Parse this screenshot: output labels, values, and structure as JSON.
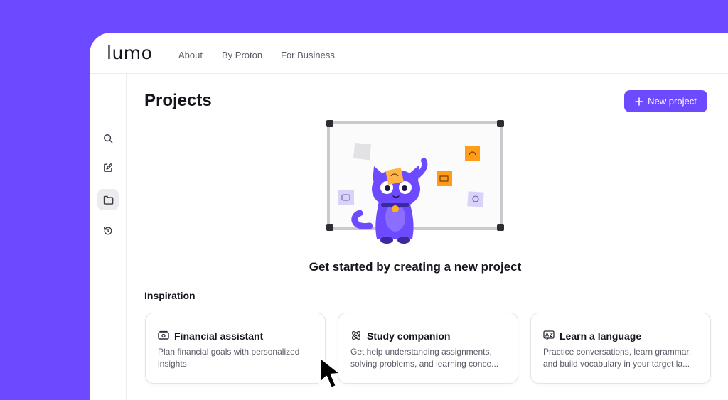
{
  "header": {
    "logo": "lumo",
    "nav": [
      "About",
      "By Proton",
      "For Business"
    ]
  },
  "sidebar": {
    "items": [
      {
        "name": "search",
        "icon": "search-icon"
      },
      {
        "name": "new-chat",
        "icon": "edit-icon"
      },
      {
        "name": "projects",
        "icon": "folder-icon",
        "active": true
      },
      {
        "name": "history",
        "icon": "history-icon"
      }
    ]
  },
  "main": {
    "title": "Projects",
    "new_project_label": "New project",
    "empty_heading": "Get started by creating a new project",
    "inspiration_label": "Inspiration",
    "cards": [
      {
        "title": "Financial assistant",
        "icon": "money-icon",
        "desc": "Plan financial goals with personalized insights"
      },
      {
        "title": "Study companion",
        "icon": "atom-icon",
        "desc": "Get help understanding assignments, solving problems, and learning conce..."
      },
      {
        "title": "Learn a language",
        "icon": "translate-icon",
        "desc": "Practice conversations, learn grammar, and build vocabulary in your target la..."
      }
    ]
  },
  "colors": {
    "brand": "#6d4aff",
    "sticky_orange": "#ff9c1a",
    "sticky_lavender": "#d9d4f7"
  }
}
